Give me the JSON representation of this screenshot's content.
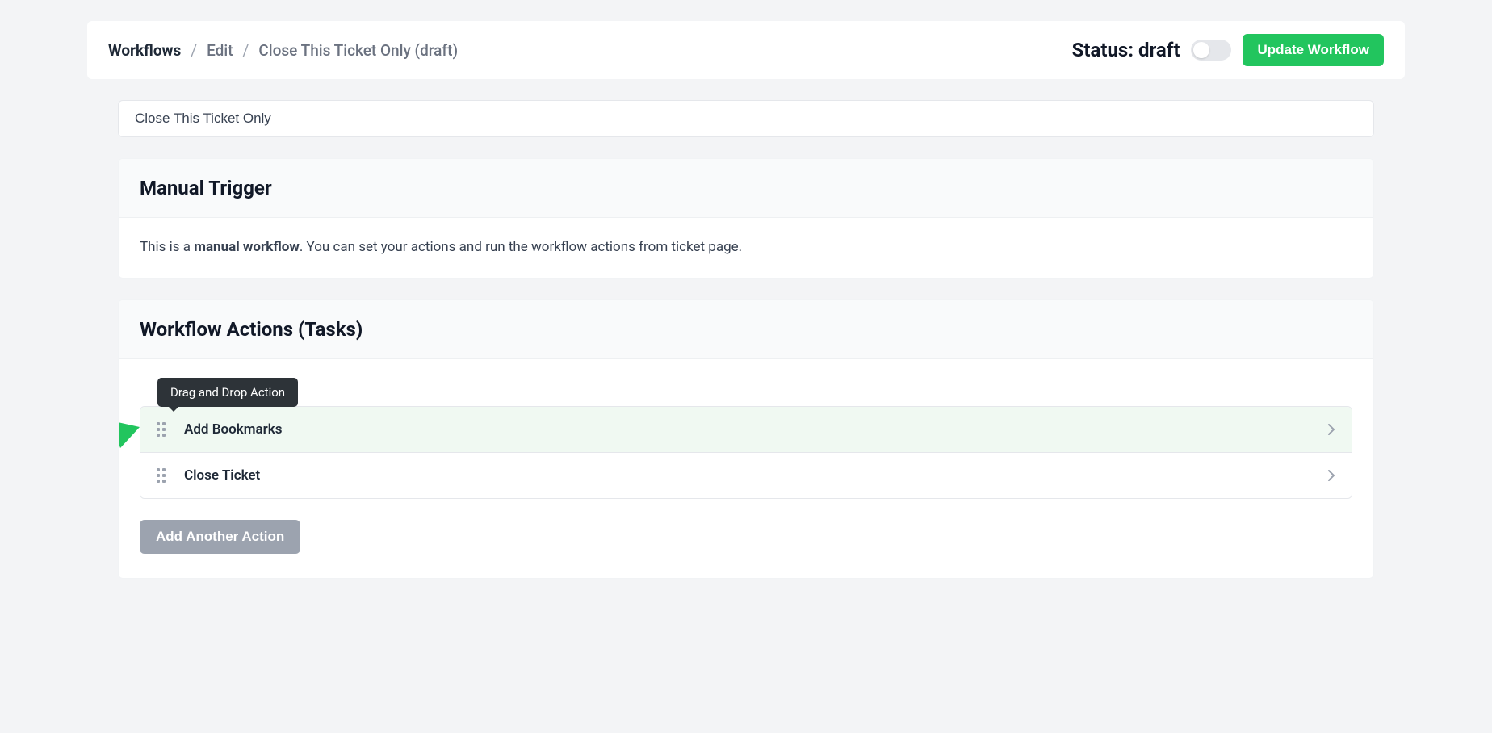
{
  "breadcrumb": {
    "root": "Workflows",
    "mid": "Edit",
    "current": "Close This Ticket Only (draft)"
  },
  "header": {
    "status_prefix": "Status:",
    "status_value": "draft",
    "update_button": "Update Workflow"
  },
  "workflow_name": "Close This Ticket Only",
  "trigger_card": {
    "title": "Manual Trigger",
    "desc_prefix": "This is a ",
    "desc_bold": "manual workflow",
    "desc_suffix": ". You can set your actions and run the workflow actions from ticket page."
  },
  "actions_card": {
    "title": "Workflow Actions (Tasks)",
    "tooltip": "Drag and Drop Action",
    "rows": [
      {
        "label": "Add Bookmarks"
      },
      {
        "label": "Close Ticket"
      }
    ],
    "add_button": "Add Another Action"
  },
  "colors": {
    "primary": "#22c55e",
    "bg": "#f3f4f6"
  }
}
